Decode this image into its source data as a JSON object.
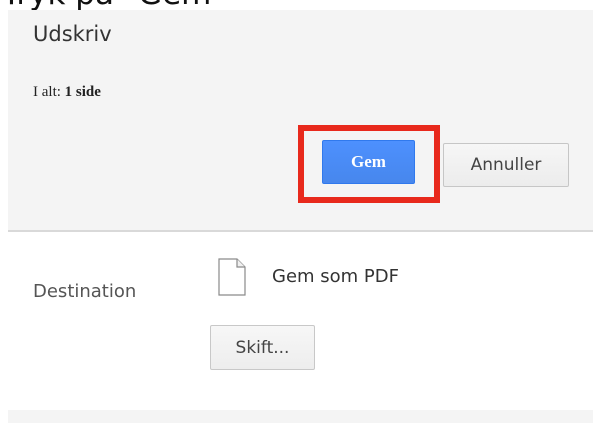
{
  "caption": "Tryk på \"Gem\"",
  "dialog": {
    "title": "Udskriv",
    "total_label": "I alt:",
    "total_value": "1 side",
    "save_button": "Gem",
    "cancel_button": "Annuller"
  },
  "destination": {
    "label": "Destination",
    "icon": "document-icon",
    "value": "Gem som PDF",
    "change_button": "Skift..."
  },
  "colors": {
    "highlight": "#e8291c",
    "primary_button": "#4d90fe",
    "panel_background": "#f4f4f4"
  }
}
